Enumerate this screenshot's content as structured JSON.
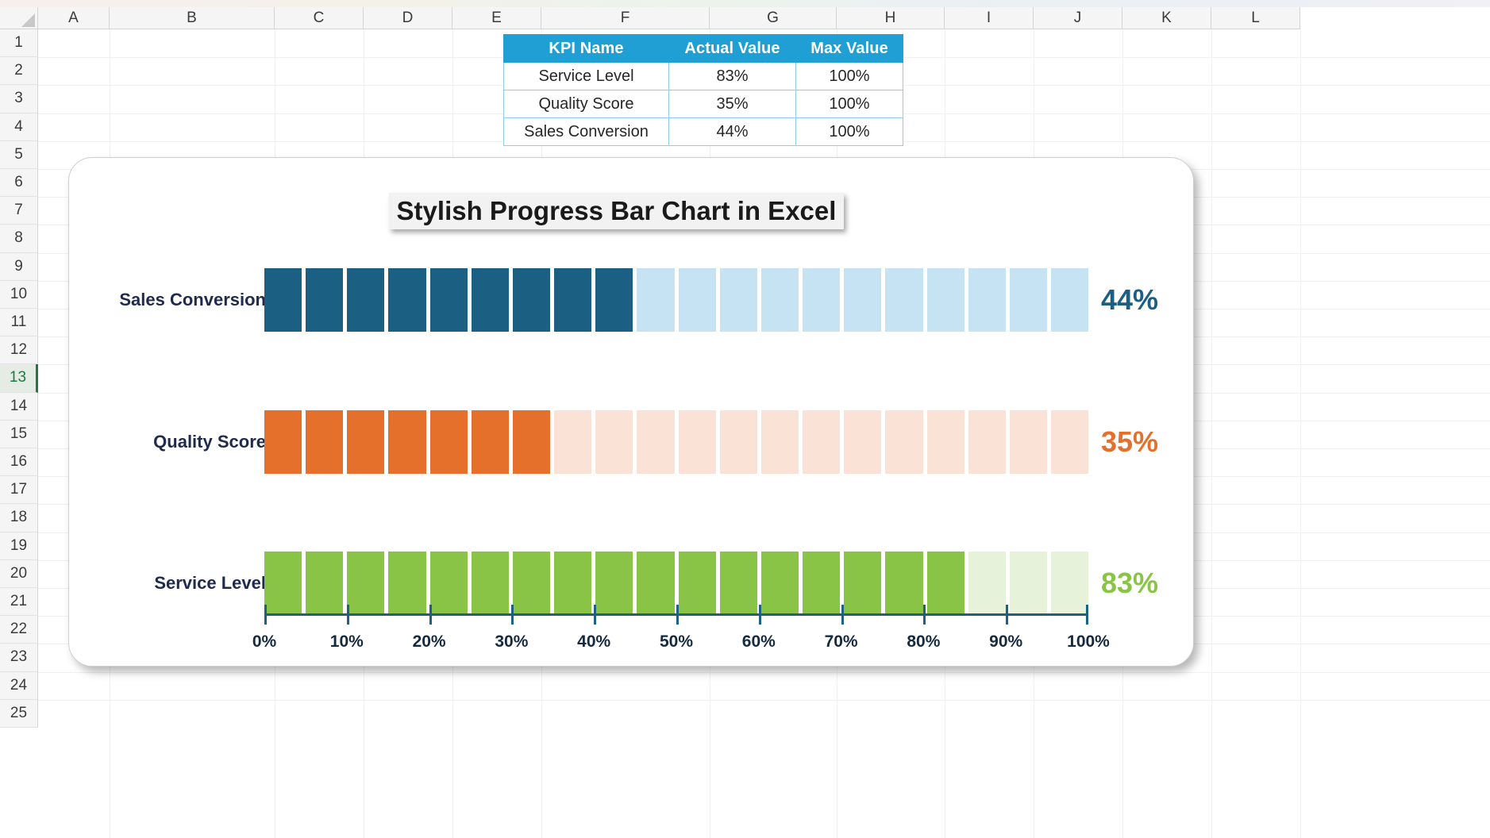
{
  "spreadsheet": {
    "columns": [
      "A",
      "B",
      "C",
      "D",
      "E",
      "F",
      "G",
      "H",
      "I",
      "J",
      "K",
      "L"
    ],
    "rows": [
      "1",
      "2",
      "3",
      "4",
      "5",
      "6",
      "7",
      "8",
      "9",
      "10",
      "11",
      "12",
      "13",
      "14",
      "15",
      "16",
      "17",
      "18",
      "19",
      "20",
      "21",
      "22",
      "23",
      "24",
      "25"
    ],
    "active_row": "13"
  },
  "kpi_table": {
    "headers": [
      "KPI Name",
      "Actual Value",
      "Max Value"
    ],
    "rows": [
      {
        "name": "Service Level",
        "actual": "83%",
        "max": "100%"
      },
      {
        "name": "Quality Score",
        "actual": "35%",
        "max": "100%"
      },
      {
        "name": "Sales Conversion",
        "actual": "44%",
        "max": "100%"
      }
    ],
    "header_bg": "#1f9fd4",
    "border_color": "#8ecdea"
  },
  "chart_data": {
    "type": "bar",
    "title": "Stylish Progress Bar Chart in Excel",
    "xlabel": "",
    "ylabel": "",
    "xlim": [
      0,
      100
    ],
    "grid": false,
    "legend": "none",
    "segments_total": 20,
    "categories": [
      "Sales Conversion",
      "Quality Score",
      "Service Level"
    ],
    "values": [
      44,
      35,
      83
    ],
    "value_labels": [
      "44%",
      "35%",
      "83%"
    ],
    "filled_segments": [
      9,
      7,
      17
    ],
    "series": [
      {
        "name": "Sales Conversion",
        "value": 44,
        "label": "44%",
        "filled": 9,
        "fill_color": "#1b5f82",
        "empty_color": "#c5e3f2",
        "label_color": "#1b5f82"
      },
      {
        "name": "Quality Score",
        "value": 35,
        "label": "35%",
        "filled": 7,
        "fill_color": "#e4702b",
        "empty_color": "#fae3d6",
        "label_color": "#e4702b"
      },
      {
        "name": "Service Level",
        "value": 83,
        "label": "83%",
        "filled": 17,
        "fill_color": "#89c447",
        "empty_color": "#e7f2da",
        "label_color": "#89c447"
      }
    ],
    "axis": {
      "ticks": [
        0,
        10,
        20,
        30,
        40,
        50,
        60,
        70,
        80,
        90,
        100
      ],
      "tick_labels": [
        "0%",
        "10%",
        "20%",
        "30%",
        "40%",
        "50%",
        "60%",
        "70%",
        "80%",
        "90%",
        "100%"
      ],
      "color": "#1b6185"
    }
  }
}
